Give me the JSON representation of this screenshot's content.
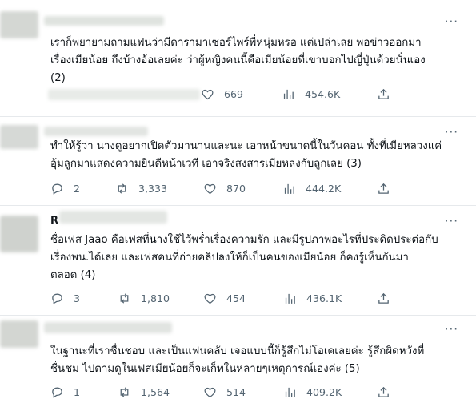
{
  "posts": [
    {
      "text": "เราก็พยายามถามแฟนว่ามีดารามาเซอร์ไพร์พี่หนุ่มหรอ แต่เปล่าเลย พอข่าวออกมา\nเรื่องเมียน้อย ถึงบ้างอ้อเลยค่ะ ว่าผู้หญิงคนนี้คือเมียน้อยที่เขาบอกไปญี่ปุ่นด้วยนั่นเอง\n(2)",
      "likes": "669",
      "views": "454.6K"
    },
    {
      "text": "ทำให้รู้ว่า นางดูอยากเปิดตัวมานานและนะ เอาหน้าขนาดนี้ในวันคอน ทั้งที่เมียหลวงแค่\nอุ้มลูกมาแสดงความยินดีหน้าเวที เอาจริงสงสารเมียหลงกับลูกเลย (3)",
      "replies": "2",
      "reposts": "3,333",
      "likes": "870",
      "views": "444.2K"
    },
    {
      "name": "R",
      "text": "ชื่อเฟส Jaao คือเฟสที่นางใช้ไว้พร่ำเรื่องความรัก และมีรูปภาพอะไรที่ประดิดประต่อกับ\nเรื่องพน.ได้เลย และเฟสคนที่ถ่ายคลิปลงให้ก็เป็นคนของเมียน้อย ก็คงรู้เห็นกันมา\nตลอด (4)",
      "replies": "3",
      "reposts": "1,810",
      "likes": "454",
      "views": "436.1K"
    },
    {
      "text": "ในฐานะที่เราชื่นชอบ และเป็นแฟนคลับ เจอแบบนี้ก็รู้สึกไม่โอเคเลยค่ะ รู้สึกผิดหวังที่\nชื่นชม ไปตามดูในเฟสเมียน้อยก็จะเก็ทในหลายๆเหตุการณ์เองค่ะ (5)",
      "replies": "1",
      "reposts": "1,564",
      "likes": "514",
      "views": "409.2K"
    }
  ],
  "more_label": "···"
}
